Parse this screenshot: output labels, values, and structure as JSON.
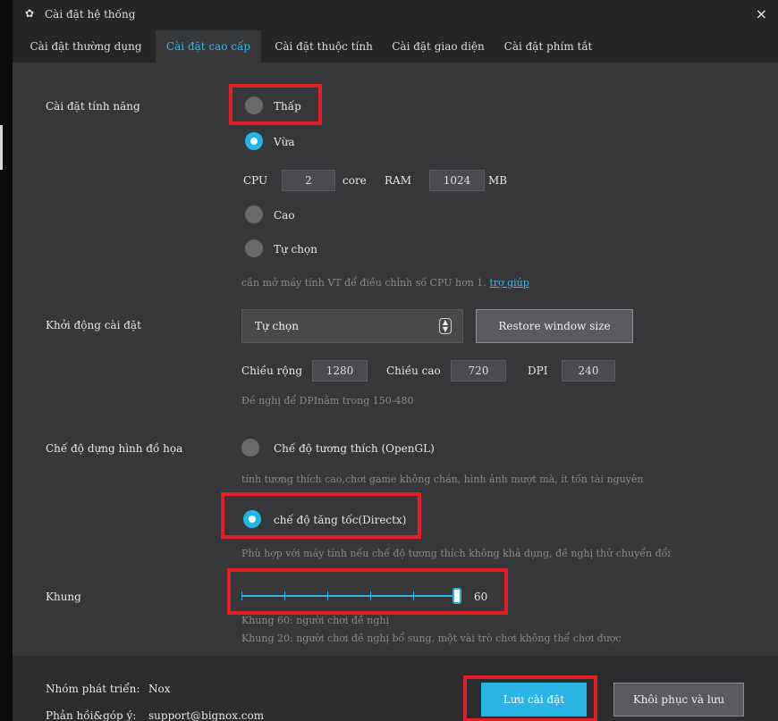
{
  "window": {
    "title": "Cài đặt hệ thống",
    "close_label": "×"
  },
  "tabs": [
    {
      "label": "Cài đặt thường dụng"
    },
    {
      "label": "Cài đặt cao cấp"
    },
    {
      "label": "Cài đặt thuộc tính"
    },
    {
      "label": "Cài đặt giao diện"
    },
    {
      "label": "Cài đặt phím tắt"
    }
  ],
  "active_tab": "Cài đặt cao cấp",
  "performance": {
    "section_label": "Cài đặt tính năng",
    "options": {
      "low": "Thấp",
      "medium": "Vừa",
      "high": "Cao",
      "custom": "Tự chọn"
    },
    "selected": "Vừa",
    "cpu_label": "CPU",
    "cpu_value": "2",
    "cpu_unit": "core",
    "ram_label": "RAM",
    "ram_value": "1024",
    "ram_unit": "MB",
    "hint_text": "cần mở máy tính VT để điều chỉnh số CPU hơn 1.",
    "hint_link": "trợ giúp"
  },
  "startup": {
    "section_label": "Khởi động cài đặt",
    "select_value": "Tự chọn",
    "restore_button": "Restore window size",
    "width_label": "Chiều rộng",
    "width_value": "1280",
    "height_label": "Chiều cao",
    "height_value": "720",
    "dpi_label": "DPI",
    "dpi_value": "240",
    "hint": "Đề nghị để DPInằm trong 150-480"
  },
  "graphics": {
    "section_label": "Chế độ dựng hình đồ họa",
    "opengl_label": "Chế độ tương thích (OpenGL)",
    "opengl_hint": "tính tương thích cao,chơi game không chán, hình ảnh mượt mà, ít tốn tài nguyên",
    "directx_label": "chế độ tăng tốc(Directx)",
    "directx_hint": "Phù hợp với máy tính nếu chế độ tương thích không khả dụng, đề nghị thử chuyển đổi",
    "selected": "chế độ tăng tốc(Directx)"
  },
  "frame": {
    "section_label": "Khung",
    "value": "60",
    "slider_fraction": 1.0,
    "hint1": "Khung 60: người chơi đề nghị",
    "hint2": "Khung 20: người chơi đề nghị bổ sung, một vài trò chơi không thể chơi được"
  },
  "footer": {
    "dev_label": "Nhóm phát triển:",
    "dev_value": "Nox",
    "feedback_label": "Phản hồi&góp ý:",
    "feedback_value": "support@bignox.com",
    "save_button": "Lưu cài đặt",
    "restore_save_button": "Khôi phục và lưu"
  },
  "colors": {
    "accent": "#29b6e6",
    "highlight_box": "#e41e26",
    "background": "#363739"
  }
}
